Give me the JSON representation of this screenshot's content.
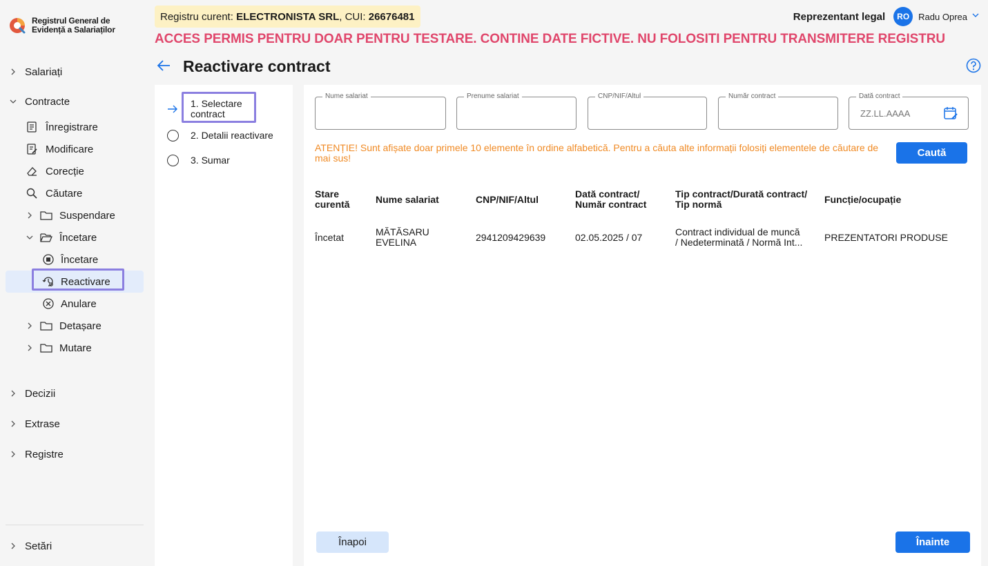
{
  "app": {
    "logo_line1": "Registrul General de",
    "logo_line2": "Evidență a Salariaților"
  },
  "header": {
    "registry_prefix": "Registru curent: ",
    "registry_company": "ELECTRONISTA SRL",
    "registry_cui_label": ", CUI: ",
    "registry_cui": "26676481",
    "warning": "ACCES PERMIS PENTRU DOAR PENTRU TESTARE. CONTINE DATE FICTIVE. NU FOLOSITI PENTRU TRANSMITERE REGISTRU",
    "user_role": "Reprezentant legal",
    "user_initials": "RO",
    "user_name": "Radu Oprea"
  },
  "sidebar": {
    "salariati": "Salariați",
    "contracte": "Contracte",
    "contracte_items": {
      "inregistrare": "Înregistrare",
      "modificare": "Modificare",
      "corectie": "Corecție",
      "cautare": "Căutare",
      "suspendare": "Suspendare",
      "incetare_group": "Încetare",
      "incetare": "Încetare",
      "reactivare": "Reactivare",
      "anulare": "Anulare",
      "detasare": "Detașare",
      "mutare": "Mutare"
    },
    "decizii": "Decizii",
    "extrase": "Extrase",
    "registre": "Registre",
    "setari": "Setări"
  },
  "page": {
    "title": "Reactivare contract"
  },
  "stepper": {
    "step1": "1. Selectare contract",
    "step2": "2. Detalii reactivare",
    "step3": "3. Sumar"
  },
  "filters": {
    "nume": "Nume salariat",
    "prenume": "Prenume salariat",
    "cnp": "CNP/NIF/Altul",
    "numar": "Număr contract",
    "data": "Dată contract",
    "data_placeholder": "ZZ.LL.AAAA"
  },
  "attention": "ATENȚIE! Sunt afișate doar primele 10 elemente în ordine alfabetică. Pentru a căuta alte informații folosiți elementele de căutare de mai sus!",
  "search_button": "Caută",
  "table": {
    "headers": {
      "stare_1": "Stare",
      "stare_2": "curentă",
      "nume": "Nume salariat",
      "cnp": "CNP/NIF/Altul",
      "data_1": "Dată contract/",
      "data_2": "Număr contract",
      "tip_1": "Tip contract/Durată contract/",
      "tip_2": "Tip normă",
      "functie": "Funcție/ocupație"
    },
    "rows": [
      {
        "stare": "Încetat",
        "nume_1": "MĂTĂSARU",
        "nume_2": "EVELINA",
        "cnp": "2941209429639",
        "data": "02.05.2025 / 07",
        "tip_1": "Contract individual de muncă",
        "tip_2": "/ Nedeterminată / Normă Int...",
        "functie": "PREZENTATORI PRODUSE"
      }
    ]
  },
  "buttons": {
    "back": "Înapoi",
    "next": "Înainte"
  },
  "colors": {
    "accent": "#1a73e8",
    "warning_red": "#e0466b",
    "attention_orange": "#f08a24",
    "highlight_box": "#8b7fe0"
  }
}
